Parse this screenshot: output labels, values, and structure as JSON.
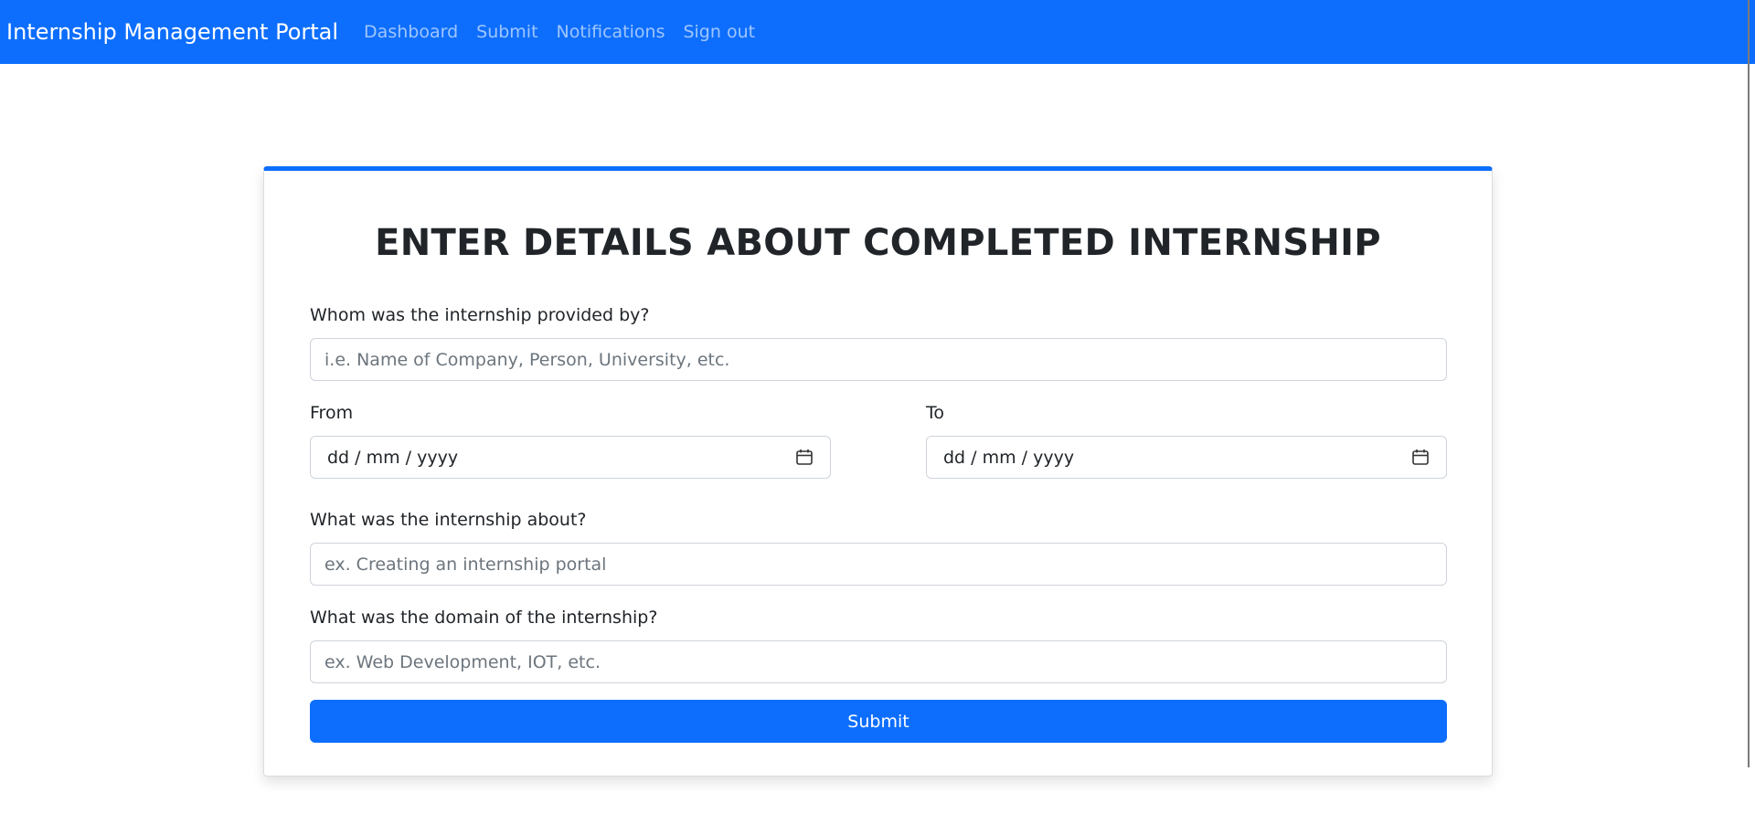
{
  "navbar": {
    "brand": "Internship Management Portal",
    "links": [
      "Dashboard",
      "Submit",
      "Notifications",
      "Sign out"
    ]
  },
  "form": {
    "title": "ENTER DETAILS ABOUT COMPLETED INTERNSHIP",
    "provider_label": "Whom was the internship provided by?",
    "provider_placeholder": "i.e. Name of Company, Person, University, etc.",
    "from_label": "From",
    "to_label": "To",
    "date_format": "dd / mm / yyyy",
    "about_label": "What was the internship about?",
    "about_placeholder": "ex. Creating an internship portal",
    "domain_label": "What was the domain of the internship?",
    "domain_placeholder": "ex. Web Development, IOT, etc.",
    "submit_label": "Submit"
  },
  "colors": {
    "primary": "#0d6efd",
    "text": "#212529",
    "placeholder": "#6c757d"
  }
}
